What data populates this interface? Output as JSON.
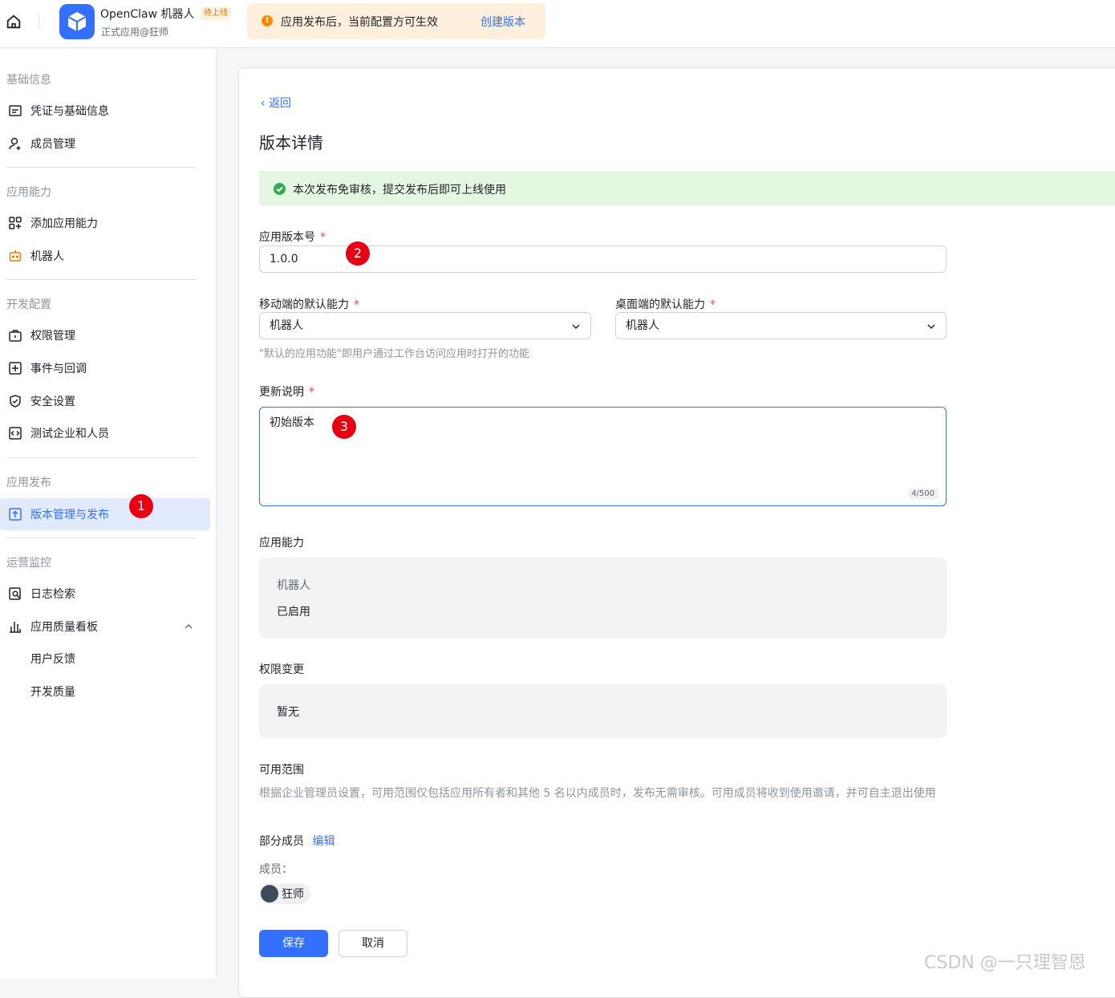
{
  "header": {
    "app_name": "OpenClaw 机器人",
    "status_badge": "待上线",
    "app_subtitle": "正式应用@狂师",
    "notice_text": "应用发布后，当前配置方可生效",
    "notice_link": "创建版本"
  },
  "sidebar": {
    "sections": [
      {
        "title": "基础信息",
        "items": [
          "凭证与基础信息",
          "成员管理"
        ]
      },
      {
        "title": "应用能力",
        "items": [
          "添加应用能力",
          "机器人"
        ]
      },
      {
        "title": "开发配置",
        "items": [
          "权限管理",
          "事件与回调",
          "安全设置",
          "测试企业和人员"
        ]
      },
      {
        "title": "应用发布",
        "items": [
          "版本管理与发布"
        ]
      },
      {
        "title": "运营监控",
        "items": [
          "日志检索",
          "应用质量看板",
          "用户反馈",
          "开发质量"
        ]
      }
    ],
    "active_item": "版本管理与发布"
  },
  "annotations": [
    "1",
    "2",
    "3"
  ],
  "main": {
    "back_label": "返回",
    "page_title": "版本详情",
    "success_message": "本次发布免审核，提交发布后即可上线使用",
    "version_label": "应用版本号",
    "version_value": "1.0.0",
    "mobile_label": "移动端的默认能力",
    "mobile_value": "机器人",
    "desktop_label": "桌面端的默认能力",
    "desktop_value": "机器人",
    "default_hint": "\"默认的应用功能\"即用户通过工作台访问应用时打开的功能",
    "notes_label": "更新说明",
    "notes_value": "初始版本",
    "notes_counter": "4/500",
    "capability_label": "应用能力",
    "capability_name": "机器人",
    "capability_status": "已启用",
    "permission_label": "权限变更",
    "permission_value": "暂无",
    "scope_label": "可用范围",
    "scope_desc": "根据企业管理员设置，可用范围仅包括应用所有者和其他 5 名以内成员时，发布无需审核。可用成员将收到使用邀请，并可自主退出使用",
    "scope_type": "部分成员",
    "scope_edit": "编辑",
    "members_label": "成员：",
    "member_name": "狂师",
    "save_label": "保存",
    "cancel_label": "取消"
  },
  "watermark": "CSDN @一只理智恩",
  "required_mark": "*"
}
